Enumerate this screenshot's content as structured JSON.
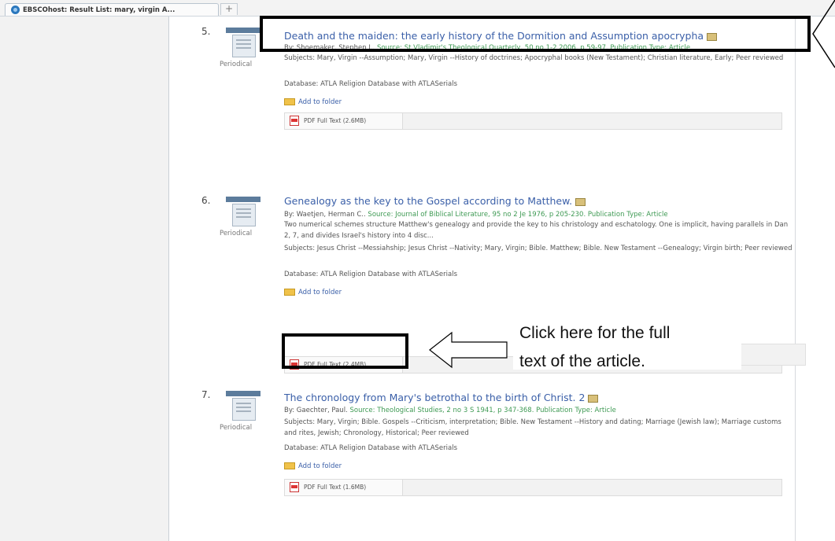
{
  "browser": {
    "tab_title": "EBSCOhost: Result List: mary, virgin A...",
    "new_tab_label": "+"
  },
  "results": [
    {
      "number": "5.",
      "publication_type": "Periodical",
      "title": "Death and the maiden: the early history of the Dormition and Assumption apocrypha",
      "author": "By: Shoemaker, Stephen J..",
      "source": "Source: St Vladimir's Theological Quarterly, 50 no 1-2 2006, p 59-97. Publication Type: Article",
      "subjects": "Subjects: Mary, Virgin --Assumption; Mary, Virgin --History of doctrines; Apocryphal books (New Testament); Christian literature, Early; Peer reviewed",
      "description": "",
      "database": "Database: ATLA Religion Database with ATLASerials",
      "add_to_folder": "Add to folder",
      "pdf_label": "PDF Full Text (2.6MB)"
    },
    {
      "number": "6.",
      "publication_type": "Periodical",
      "title": "Genealogy as the key to the Gospel according to Matthew.",
      "author": "By: Waetjen, Herman C..",
      "source": "Source: Journal of Biblical Literature, 95 no 2 Je 1976, p 205-230. Publication Type: Article",
      "description": "Two numerical schemes structure Matthew's genealogy and provide the key to his christology and eschatology. One is implicit, having parallels in Dan 2, 7, and divides Israel's history into 4 disc...",
      "subjects": "Subjects: Jesus Christ --Messiahship; Jesus Christ --Nativity; Mary, Virgin; Bible. Matthew; Bible. New Testament --Genealogy; Virgin birth; Peer reviewed",
      "database": "Database: ATLA Religion Database with ATLASerials",
      "add_to_folder": "Add to folder",
      "pdf_label": "PDF Full Text (2.4MB)"
    },
    {
      "number": "7.",
      "publication_type": "Periodical",
      "title": "The chronology from Mary's betrothal to the birth of Christ. 2",
      "author": "By: Gaechter, Paul.",
      "source": "Source: Theological Studies, 2 no 3 S 1941, p 347-368. Publication Type: Article",
      "subjects": "Subjects: Mary, Virgin; Bible. Gospels --Criticism, interpretation; Bible. New Testament --History and dating; Marriage (Jewish law); Marriage customs and rites, Jewish; Chronology, Historical; Peer reviewed",
      "description": "",
      "database": "Database: ATLA Religion Database with ATLASerials",
      "add_to_folder": "Add to folder",
      "pdf_label": "PDF Full Text (1.6MB)"
    }
  ],
  "annotation": {
    "line1": "Click here for the full",
    "line2": "text of the article."
  }
}
